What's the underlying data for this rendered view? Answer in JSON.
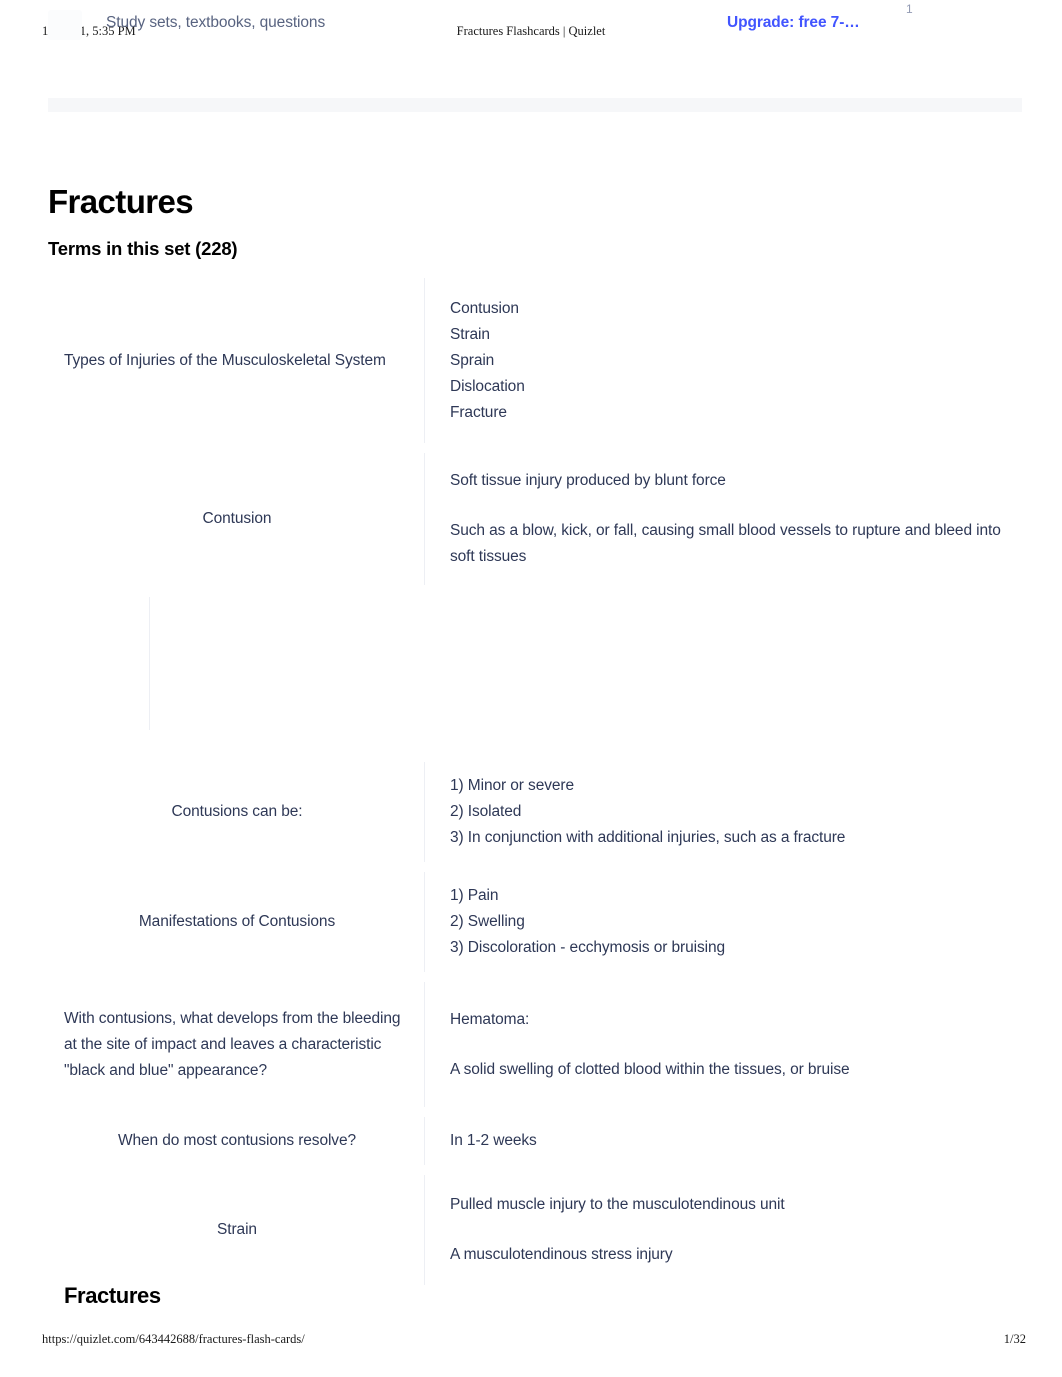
{
  "print_header": {
    "left": "11/20/21, 5:35 PM",
    "center": "Fractures Flashcards | Quizlet"
  },
  "print_footer": {
    "url": "https://quizlet.com/643442688/fractures-flash-cards/",
    "page": "1/32"
  },
  "nav": {
    "search_placeholder": "Study sets, textbooks, questions",
    "upgrade_label": "Upgrade: free 7-…",
    "badge": "1"
  },
  "main": {
    "title": "Fractures",
    "section_heading": "Terms in this set (228)",
    "bottom_heading": "Fractures"
  },
  "cards": [
    {
      "term": "Types of Injuries of the Musculoskeletal System",
      "definition": "Contusion\nStrain\nSprain\nDislocation\nFracture"
    },
    {
      "term": "Contusion",
      "definition_blocks": [
        "Soft tissue injury produced by blunt force",
        "Such as a blow, kick, or fall, causing small blood vessels to rupture and bleed into soft tissues"
      ]
    },
    {
      "term": "",
      "definition": ""
    },
    {
      "term": "Contusions can be:",
      "definition": "1) Minor or severe\n2) Isolated\n3) In conjunction with additional injuries, such as a fracture"
    },
    {
      "term": "Manifestations of Contusions",
      "definition": "1) Pain\n2) Swelling\n3) Discoloration - ecchymosis or bruising"
    },
    {
      "term": "With contusions, what develops from the bleeding at the site of impact and leaves a characteristic \"black and blue\" appearance?",
      "definition_blocks": [
        "Hematoma:",
        "A solid swelling of clotted blood within the tissues, or bruise"
      ]
    },
    {
      "term": "When do most contusions resolve?",
      "definition": "In 1-2 weeks"
    },
    {
      "term": "Strain",
      "definition_blocks": [
        "Pulled muscle injury to the musculotendinous unit",
        "A musculotendinous stress injury"
      ]
    }
  ],
  "colors": {
    "accent": "#4255ff",
    "text": "#2e3856",
    "heading": "#000000",
    "card_bg": "#ffffff",
    "page_bg": "#f6f7f9",
    "divider": "#edeff4"
  }
}
